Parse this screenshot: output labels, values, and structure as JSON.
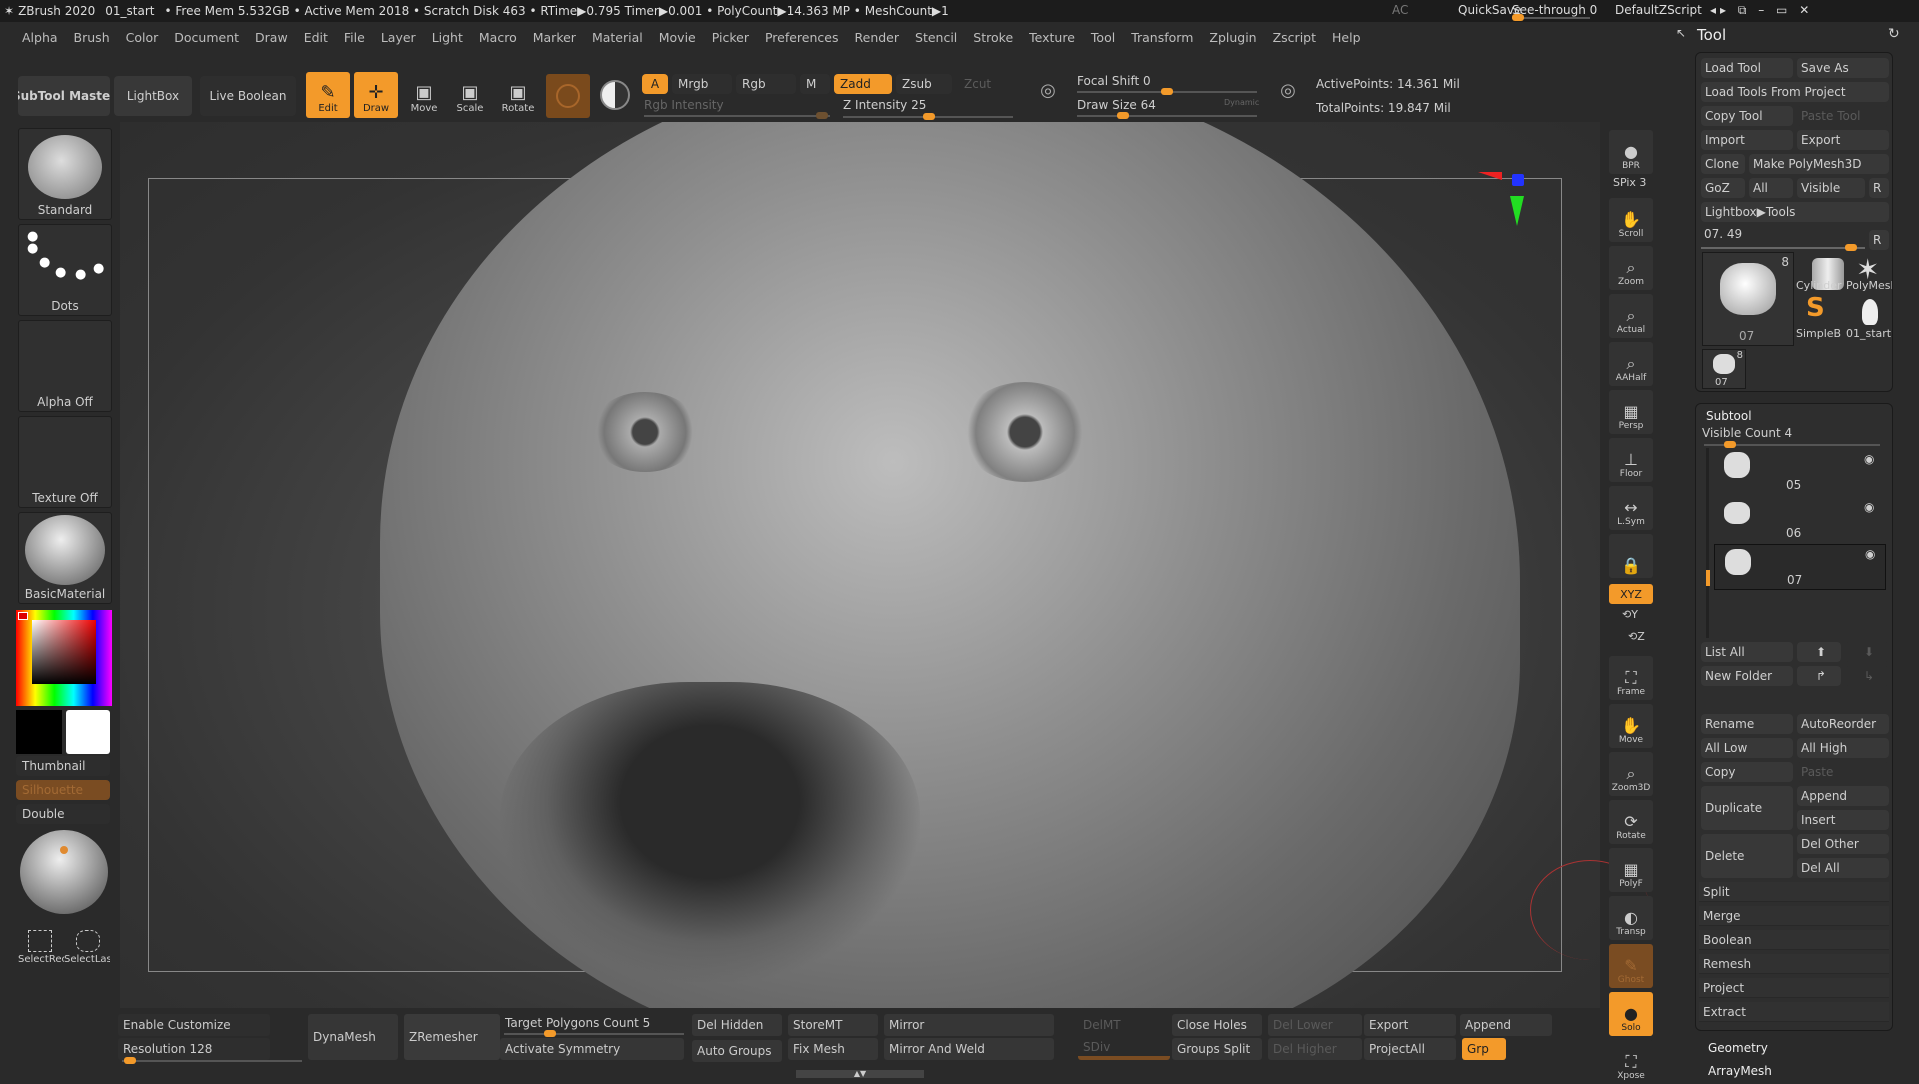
{
  "titlebar": {
    "app": "ZBrush 2020",
    "file": "01_start",
    "stats": "• Free Mem 5.532GB • Active Mem 2018 • Scratch Disk 463 • RTime▶0.795 Timer▶0.001 • PolyCount▶14.363 MP • MeshCount▶1",
    "ac": "AC",
    "quicksave": "QuickSave",
    "seethrough": "See-through  0",
    "script": "DefaultZScript"
  },
  "menu": [
    "Alpha",
    "Brush",
    "Color",
    "Document",
    "Draw",
    "Edit",
    "File",
    "Layer",
    "Light",
    "Macro",
    "Marker",
    "Material",
    "Movie",
    "Picker",
    "Preferences",
    "Render",
    "Stencil",
    "Stroke",
    "Texture",
    "Tool",
    "Transform",
    "Zplugin",
    "Zscript",
    "Help"
  ],
  "toolbar": {
    "subtool_master": "SubTool Master",
    "lightbox": "LightBox",
    "live_boolean": "Live Boolean",
    "edit": "Edit",
    "draw": "Draw",
    "move": "Move",
    "scale": "Scale",
    "rotate": "Rotate",
    "a": "A",
    "mrgb": "Mrgb",
    "rgb": "Rgb",
    "m": "M",
    "zadd": "Zadd",
    "zsub": "Zsub",
    "zcut": "Zcut",
    "rgb_intensity": "Rgb Intensity",
    "z_intensity": "Z Intensity 25",
    "focal_shift": "Focal Shift 0",
    "draw_size": "Draw Size 64",
    "dynamic": "Dynamic",
    "active_points": "ActivePoints: 14.361 Mil",
    "total_points": "TotalPoints: 19.847 Mil",
    "z_intensity_value": 25,
    "focal_shift_value": 0,
    "draw_size_value": 64,
    "accent": "#f39a2a"
  },
  "left_shelf": {
    "brush": "Standard",
    "stroke": "Dots",
    "alpha": "Alpha Off",
    "texture": "Texture Off",
    "material": "BasicMaterial",
    "thumbnail": "Thumbnail",
    "silhouette": "Silhouette",
    "double": "Double",
    "select_rect": "SelectRect",
    "select_lasso": "SelectLasso"
  },
  "right_shelf": [
    "BPR",
    "SPix 3",
    "Scroll",
    "Zoom",
    "Actual",
    "AAHalf",
    "Persp",
    "Floor",
    "L.Sym",
    "",
    "XYZ",
    "Frame",
    "Move",
    "Zoom3D",
    "Rotate",
    "PolyF",
    "Transp",
    "Ghost",
    "Solo",
    "Xpose"
  ],
  "tool_panel": {
    "title": "Tool",
    "load_tool": "Load Tool",
    "save_as": "Save As",
    "load_from_project": "Load Tools From Project",
    "copy_tool": "Copy Tool",
    "paste_tool": "Paste Tool",
    "import": "Import",
    "export": "Export",
    "clone": "Clone",
    "make_polymesh": "Make PolyMesh3D",
    "goz": "GoZ",
    "all": "All",
    "visible": "Visible",
    "r": "R",
    "lightbox_tools": "Lightbox▶Tools",
    "tool_slider": "07. 49",
    "thumbs": [
      {
        "name": "07",
        "count": "8"
      },
      {
        "name": "Cylinder"
      },
      {
        "name": "PolyMesh"
      },
      {
        "name": "SimpleB"
      },
      {
        "name": "01_start"
      },
      {
        "name": "07",
        "count": "8"
      }
    ]
  },
  "subtool": {
    "title": "Subtool",
    "visible_count": "Visible Count 4",
    "items": [
      "05",
      "06",
      "07"
    ],
    "list_all": "List All",
    "new_folder": "New Folder",
    "rename": "Rename",
    "autoreorder": "AutoReorder",
    "all_low": "All Low",
    "all_high": "All High",
    "copy": "Copy",
    "paste": "Paste",
    "duplicate": "Duplicate",
    "append": "Append",
    "insert": "Insert",
    "delete": "Delete",
    "del_other": "Del Other",
    "del_all": "Del All",
    "sections": [
      "Split",
      "Merge",
      "Boolean",
      "Remesh",
      "Project",
      "Extract"
    ]
  },
  "tool_sections": [
    "Geometry",
    "ArrayMesh"
  ],
  "bottom": {
    "enable_customize": "Enable Customize",
    "resolution": "Resolution 128",
    "dynamesh": "DynaMesh",
    "zremesher": "ZRemesher",
    "target_polygons": "Target Polygons Count 5",
    "activate_symmetry": "Activate Symmetry",
    "del_hidden": "Del Hidden",
    "auto_groups": "Auto Groups",
    "storemt": "StoreMT",
    "fix_mesh": "Fix Mesh",
    "mirror": "Mirror",
    "mirror_weld": "Mirror And Weld",
    "delmt": "DelMT",
    "sdiv": "SDiv",
    "close_holes": "Close Holes",
    "groups_split": "Groups Split",
    "del_lower": "Del Lower",
    "del_higher": "Del Higher",
    "export": "Export",
    "projectall": "ProjectAll",
    "append": "Append",
    "grp": "Grp"
  }
}
